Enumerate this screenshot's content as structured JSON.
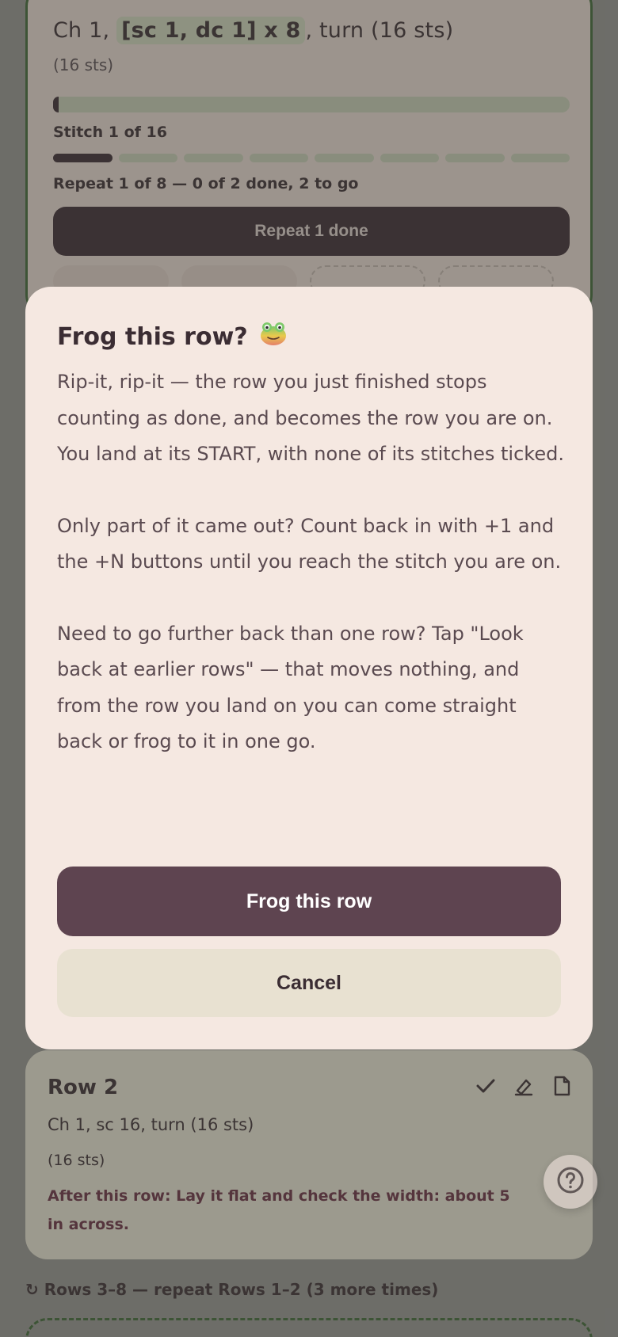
{
  "current_row": {
    "instruction_prefix": "Ch 1,",
    "instruction_highlight": "[sc 1, dc 1] x 8",
    "instruction_suffix": ", turn (16 sts)",
    "stitch_count": "(16 sts)",
    "row_progress": 0.01,
    "stitch_label": "Stitch 1 of 16",
    "repeat_segments_total": 8,
    "repeat_segments_done": 1,
    "repeat_label": "Repeat 1 of 8 — 0 of 2 done, 2 to go",
    "repeat_button": "Repeat 1 done"
  },
  "modal": {
    "title": "Frog this row?",
    "icon": "frog-emoji-icon",
    "paragraphs": [
      "Rip-it, rip-it — the row you just finished stops counting as done, and becomes the row you are on. You land at its START, with none of its stitches ticked.",
      "Only part of it came out? Count back in with +1 and the +N buttons until you reach the stitch you are on.",
      "Need to go further back than one row? Tap \"Look back at earlier rows\" — that moves nothing, and from the row you land on you can come straight back or frog to it in one go."
    ],
    "confirm_label": "Frog this row",
    "cancel_label": "Cancel"
  },
  "next_row": {
    "title": "Row 2",
    "instruction": "Ch 1, sc 16, turn (16 sts)",
    "stitch_count": "(16 sts)",
    "after_note": "After this row: Lay it flat and check the width: about 5 in across.",
    "icons": [
      "check-icon",
      "highlighter-icon",
      "note-icon"
    ]
  },
  "repeat_note": "↻ Rows 3–8 — repeat Rows 1–2 (3 more times)",
  "help_icon": "help-icon",
  "colors": {
    "accent_dark": "#3a2a32",
    "modal_bg": "#f5e8e1",
    "primary_button": "#5e4450",
    "secondary_button": "#e8e1d1",
    "current_border": "#3f6a36"
  }
}
